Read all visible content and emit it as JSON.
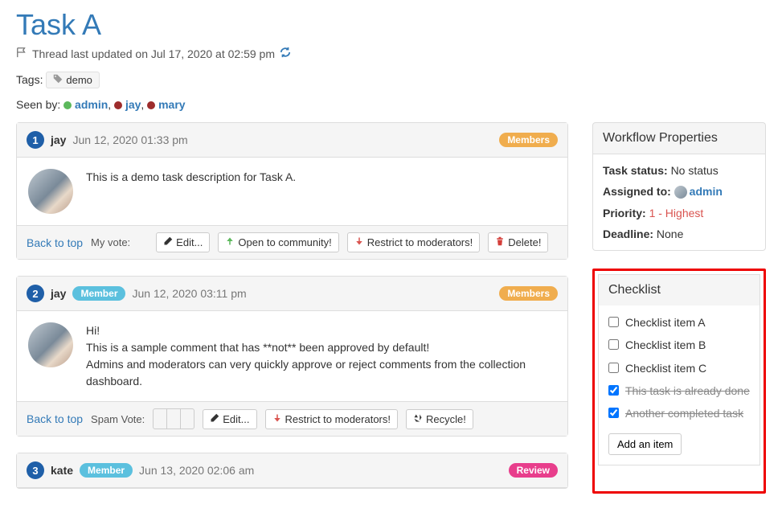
{
  "title": "Task A",
  "thread_updated": "Thread last updated on Jul 17, 2020 at 02:59 pm",
  "tags_label": "Tags:",
  "tags": [
    "demo"
  ],
  "seen_label": "Seen by:",
  "seen_by": [
    {
      "name": "admin",
      "color": "#5cb85c"
    },
    {
      "name": "jay",
      "color": "#9d2c2c"
    },
    {
      "name": "mary",
      "color": "#9d2c2c"
    }
  ],
  "comments": [
    {
      "num": "1",
      "author": "jay",
      "ts": "Jun 12, 2020 01:33 pm",
      "badges": [
        {
          "text": "Members",
          "cls": "badge-orange"
        }
      ],
      "member_inline": null,
      "body_lines": [
        "This is a demo task description for Task A."
      ],
      "foot_vote_label": "My vote:",
      "foot_vote_style": "icons",
      "foot_buttons": [
        {
          "icon": "edit",
          "label": "Edit...",
          "icls": ""
        },
        {
          "icon": "up",
          "label": "Open to community!",
          "icls": "icn-green"
        },
        {
          "icon": "down",
          "label": "Restrict to moderators!",
          "icls": "icn-pink"
        },
        {
          "icon": "trash",
          "label": "Delete!",
          "icls": "icn-red"
        }
      ]
    },
    {
      "num": "2",
      "author": "jay",
      "ts": "Jun 12, 2020 03:11 pm",
      "badges": [
        {
          "text": "Members",
          "cls": "badge-orange"
        }
      ],
      "member_inline": "Member",
      "body_lines": [
        "Hi!",
        "This is a sample comment that has **not** been approved by default!",
        "Admins and moderators can very quickly approve or reject comments from the collection dashboard."
      ],
      "foot_vote_label": "Spam Vote:",
      "foot_vote_style": "box",
      "foot_buttons": [
        {
          "icon": "edit",
          "label": "Edit...",
          "icls": ""
        },
        {
          "icon": "down",
          "label": "Restrict to moderators!",
          "icls": "icn-pink"
        },
        {
          "icon": "recycle",
          "label": "Recycle!",
          "icls": ""
        }
      ]
    },
    {
      "num": "3",
      "author": "kate",
      "ts": "Jun 13, 2020 02:06 am",
      "badges": [
        {
          "text": "Review",
          "cls": "badge-pink"
        }
      ],
      "member_inline": "Member",
      "body_lines": [],
      "foot_vote_label": null,
      "foot_vote_style": null,
      "foot_buttons": []
    }
  ],
  "back_to_top": "Back to top",
  "workflow": {
    "heading": "Workflow Properties",
    "status_label": "Task status:",
    "status_value": "No status",
    "assigned_label": "Assigned to:",
    "assigned_value": "admin",
    "priority_label": "Priority:",
    "priority_value": "1 - Highest",
    "deadline_label": "Deadline:",
    "deadline_value": "None"
  },
  "checklist": {
    "heading": "Checklist",
    "items": [
      {
        "label": "Checklist item A",
        "done": false
      },
      {
        "label": "Checklist item B",
        "done": false
      },
      {
        "label": "Checklist item C",
        "done": false
      },
      {
        "label": "This task is already done",
        "done": true
      },
      {
        "label": "Another completed task",
        "done": true
      }
    ],
    "add_label": "Add an item"
  }
}
